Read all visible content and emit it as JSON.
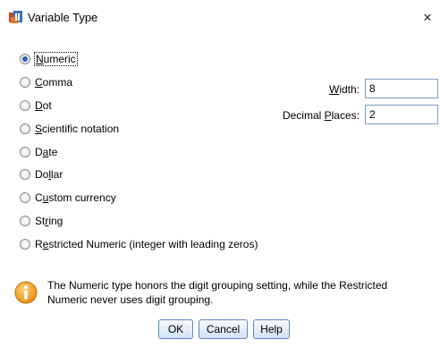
{
  "window": {
    "title": "Variable Type",
    "close_glyph": "×",
    "app_icon": "spss-app-icon"
  },
  "variable_types": [
    {
      "pre": "",
      "accel": "N",
      "post": "umeric",
      "selected": true
    },
    {
      "pre": "",
      "accel": "C",
      "post": "omma",
      "selected": false
    },
    {
      "pre": "",
      "accel": "D",
      "post": "ot",
      "selected": false
    },
    {
      "pre": "",
      "accel": "S",
      "post": "cientific notation",
      "selected": false
    },
    {
      "pre": "D",
      "accel": "a",
      "post": "te",
      "selected": false
    },
    {
      "pre": "Do",
      "accel": "l",
      "post": "lar",
      "selected": false
    },
    {
      "pre": "C",
      "accel": "u",
      "post": "stom currency",
      "selected": false
    },
    {
      "pre": "St",
      "accel": "r",
      "post": "ing",
      "selected": false
    },
    {
      "pre": "R",
      "accel": "e",
      "post": "stricted Numeric (integer with leading zeros)",
      "selected": false
    }
  ],
  "width_field": {
    "pre": "",
    "accel": "W",
    "post": "idth:",
    "value": "8"
  },
  "decimal_field": {
    "pre": "Decimal ",
    "accel": "P",
    "post": "laces:",
    "value": "2"
  },
  "info": {
    "icon": "info-icon",
    "text": "The Numeric type honors the digit grouping setting, while the Restricted Numeric never uses digit grouping."
  },
  "buttons": {
    "ok": "OK",
    "cancel": "Cancel",
    "help": "Help"
  },
  "colors": {
    "accent": "#2b63b8",
    "info_icon": "#f0a020",
    "button_border": "#5f87c2"
  }
}
